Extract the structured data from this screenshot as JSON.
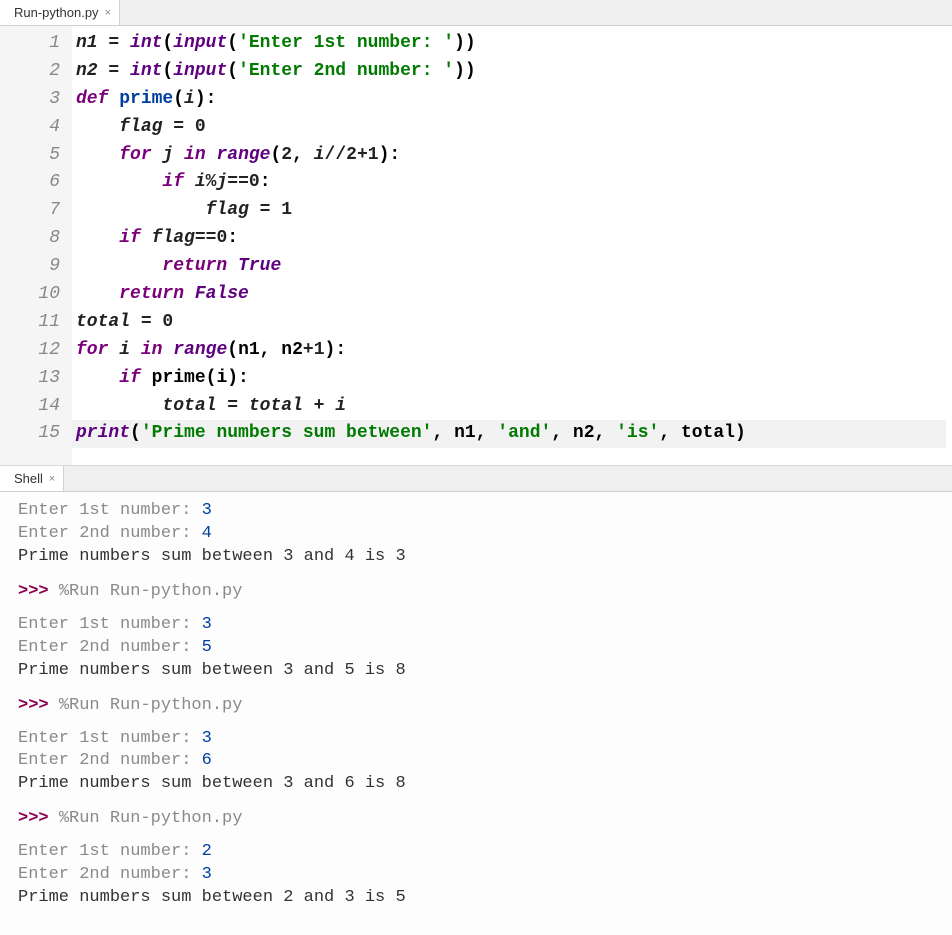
{
  "editor_tab": {
    "title": "Run-python.py",
    "close": "×"
  },
  "shell_tab": {
    "title": "Shell",
    "close": "×"
  },
  "code": {
    "lines": [
      "1",
      "2",
      "3",
      "4",
      "5",
      "6",
      "7",
      "8",
      "9",
      "10",
      "11",
      "12",
      "13",
      "14",
      "15"
    ],
    "l1_a": "n1 ",
    "l1_eq": "= ",
    "l1_int": "int",
    "l1_p1": "(",
    "l1_input": "input",
    "l1_p2": "(",
    "l1_str": "'Enter 1st number: '",
    "l1_p3": "))",
    "l2_a": "n2 ",
    "l2_eq": "= ",
    "l2_int": "int",
    "l2_p1": "(",
    "l2_input": "input",
    "l2_p2": "(",
    "l2_str": "'Enter 2nd number: '",
    "l2_p3": "))",
    "l3_def": "def",
    "l3_sp": " ",
    "l3_name": "prime",
    "l3_p": "(",
    "l3_i": "i",
    "l3_pc": "):",
    "l4_ind": "    ",
    "l4_flag": "flag ",
    "l4_eq": "= ",
    "l4_z": "0",
    "l5_ind": "    ",
    "l5_for": "for",
    "l5_sp1": " ",
    "l5_j": "j ",
    "l5_in": "in",
    "l5_sp2": " ",
    "l5_range": "range",
    "l5_p1": "(",
    "l5_2": "2",
    "l5_c": ", ",
    "l5_i": "i",
    "l5_fd": "//",
    "l5_2b": "2",
    "l5_plus": "+",
    "l5_1": "1",
    "l5_p2": "):",
    "l6_ind": "        ",
    "l6_if": "if",
    "l6_sp": " ",
    "l6_i": "i",
    "l6_mod": "%",
    "l6_j": "j",
    "l6_eqeq": "==",
    "l6_z": "0",
    "l6_col": ":",
    "l7_ind": "            ",
    "l7_flag": "flag ",
    "l7_eq": "= ",
    "l7_1": "1",
    "l8_ind": "    ",
    "l8_if": "if",
    "l8_sp": " ",
    "l8_flag": "flag",
    "l8_eqeq": "==",
    "l8_z": "0",
    "l8_col": ":",
    "l9_ind": "        ",
    "l9_ret": "return",
    "l9_sp": " ",
    "l9_true": "True",
    "l10_ind": "    ",
    "l10_ret": "return",
    "l10_sp": " ",
    "l10_false": "False",
    "l11_a": "total ",
    "l11_eq": "= ",
    "l11_z": "0",
    "l12_for": "for",
    "l12_sp1": " ",
    "l12_i": "i ",
    "l12_in": "in",
    "l12_sp2": " ",
    "l12_range": "range",
    "l12_p1": "(n1, n2",
    "l12_plus": "+",
    "l12_1": "1",
    "l12_p2": "):",
    "l13_ind": "    ",
    "l13_if": "if",
    "l13_sp": " ",
    "l13_prime": "prime(i):",
    "l14_ind": "        ",
    "l14_a": "total ",
    "l14_eq": "= ",
    "l14_b": "total ",
    "l14_plus": "+ ",
    "l14_i": "i",
    "l15_print": "print",
    "l15_p1": "(",
    "l15_s1": "'Prime numbers sum between'",
    "l15_c1": ", n1, ",
    "l15_s2": "'and'",
    "l15_c2": ", n2, ",
    "l15_s3": "'is'",
    "l15_c3": ", total)"
  },
  "shell": {
    "ppp": ">>> ",
    "run": "%Run Run-python.py",
    "p1": "Enter 1st number: ",
    "p2": "Enter 2nd number: ",
    "runs": [
      {
        "in1": "3",
        "in2": "4",
        "out": "Prime numbers sum between 3 and 4 is 3"
      },
      {
        "in1": "3",
        "in2": "5",
        "out": "Prime numbers sum between 3 and 5 is 8"
      },
      {
        "in1": "3",
        "in2": "6",
        "out": "Prime numbers sum between 3 and 6 is 8"
      },
      {
        "in1": "2",
        "in2": "3",
        "out": "Prime numbers sum between 2 and 3 is 5"
      }
    ]
  }
}
